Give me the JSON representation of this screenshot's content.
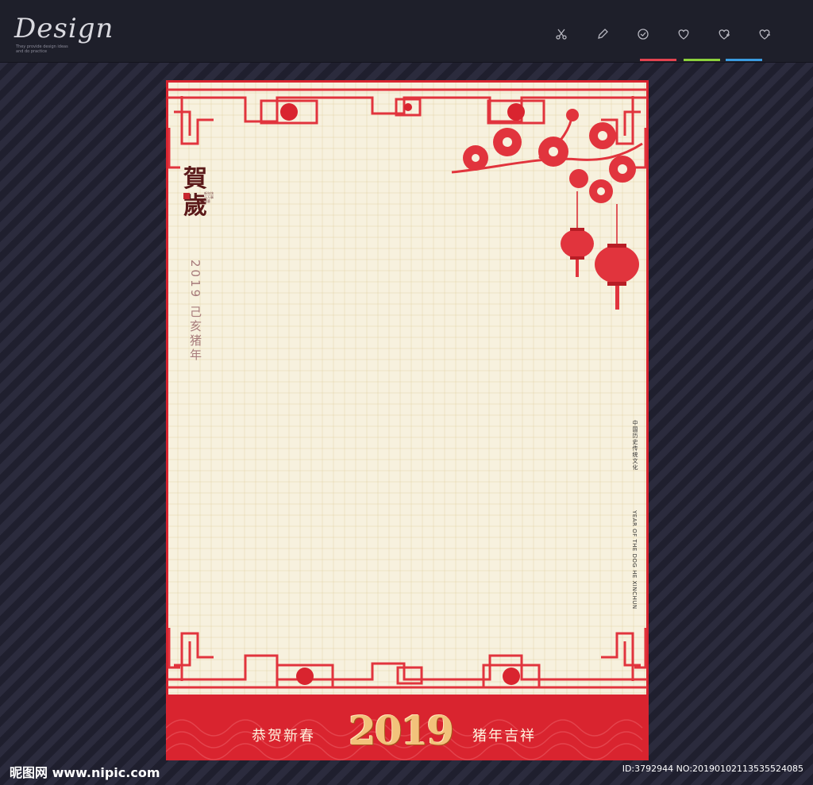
{
  "header": {
    "logo_text": "Design",
    "logo_tagline": "They provide design ideas and do practice",
    "tools": [
      {
        "icon": "scissors-icon",
        "label": "✂"
      },
      {
        "icon": "pencil-icon",
        "label": "✎"
      },
      {
        "icon": "check-circle-icon",
        "label": "◷"
      },
      {
        "icon": "heart-icon",
        "label": "♡"
      },
      {
        "icon": "heart-plus-icon",
        "label": "♡"
      },
      {
        "icon": "heart-minus-icon",
        "label": "♡"
      }
    ],
    "underline_colors": [
      "#e2424f",
      "#8bd13c",
      "#3a9be0"
    ]
  },
  "card": {
    "he_sui": "賀歲",
    "he_sui_small": "新年快乐万事如意",
    "vertical_year": "2019 己亥猪年",
    "vertical_right_cn": "中国历史传统文化",
    "vertical_right_en": "YEAR OF THE DOG HE XINCHUN",
    "banner_left": "恭贺新春",
    "banner_year": "2019",
    "banner_right": "猪年吉祥"
  },
  "watermark": {
    "left": "昵图网 www.nipic.com",
    "right": "ID:3792944 NO:20190102113535524085"
  },
  "colors": {
    "accent_red": "#d9242f",
    "paper": "#f7f1de",
    "gold": "#f2c27b"
  }
}
